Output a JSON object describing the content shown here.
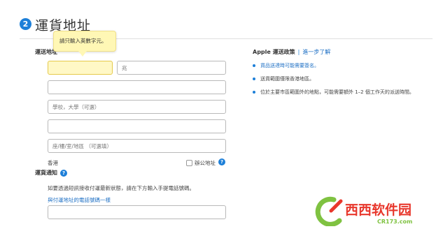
{
  "section": {
    "step_number": "2",
    "title": "運貨地址"
  },
  "tooltip": {
    "text": "請只輸入英數字元。"
  },
  "form": {
    "address_label": "運送地址",
    "first_name": {
      "value": "",
      "placeholder": ""
    },
    "last_name": {
      "value": "",
      "placeholder": "兆"
    },
    "address_line1": {
      "value": "",
      "placeholder": ""
    },
    "school": {
      "value": "",
      "placeholder": "學校，大學（可選）"
    },
    "address_line2": {
      "value": "",
      "placeholder": ""
    },
    "floor": {
      "value": "",
      "placeholder": "座/樓/室/地區 （可選填）"
    },
    "region": "香港",
    "office_checkbox_label": "辦公地址",
    "notification_label": "運貨通知",
    "notification_desc": "如要透過短訊接收付運最新狀態，請在下方輸入手提電話號碼。",
    "same_phone_link": "與付運地址的電話號碼一樣",
    "phone": {
      "value": "",
      "placeholder": ""
    }
  },
  "policy": {
    "apple_label": "Apple 運送政策",
    "separator": "|",
    "learn_more": "進一步了解",
    "bullets": [
      "貨品送達時可能需要簽名。",
      "送貨範圍僅限香港地區。",
      "位於主要市區範圍外的地點，可能需要額外 1–2 個工作天的派送時間。"
    ]
  },
  "watermark": {
    "text_cn": "西西软件园",
    "text_en": "CR173.com",
    "color_green": "#7fc241",
    "color_red": "#e8372c"
  }
}
